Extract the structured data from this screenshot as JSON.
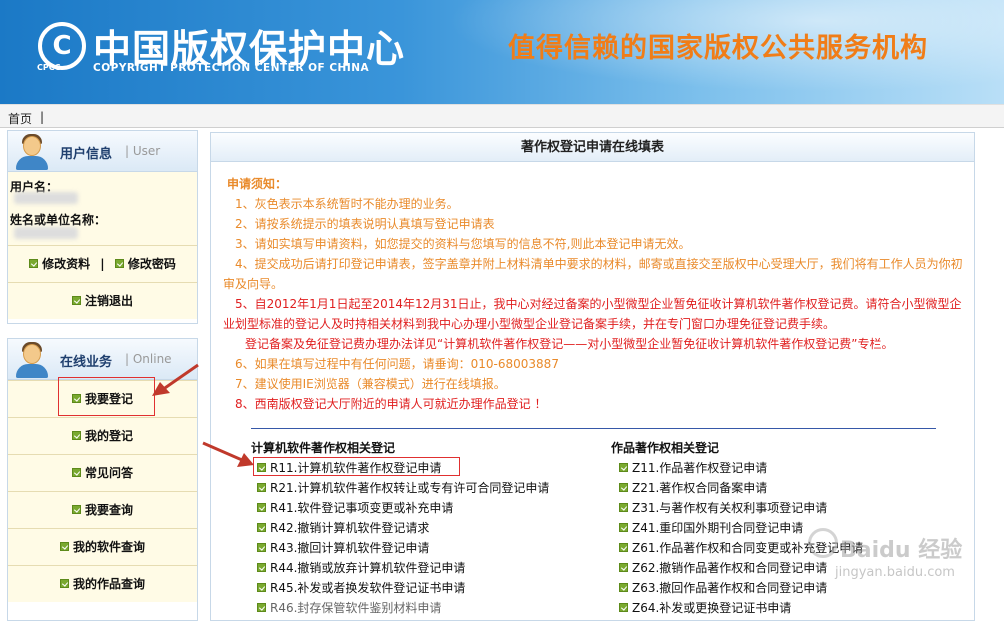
{
  "header": {
    "logo_circle": "C",
    "logo_abbr": "CPCC",
    "logo_cn": "中国版权保护中心",
    "logo_en": "COPYRIGHT PROTECTION CENTER OF CHINA",
    "slogan": "值得信赖的国家版权公共服务机构"
  },
  "breadcrumb": {
    "home": "首页",
    "sep": "|"
  },
  "user_box": {
    "title": "用户信息",
    "sub": "| User",
    "username_label": "用户名：",
    "name_label": "姓名或单位名称：",
    "edit_profile": "修改资料",
    "divider": "|",
    "edit_password": "修改密码",
    "logout": "注销退出"
  },
  "online_box": {
    "title": "在线业务",
    "sub": "| Online",
    "items": [
      {
        "label": "我要登记"
      },
      {
        "label": "我的登记"
      },
      {
        "label": "常见问答"
      },
      {
        "label": "我要查询"
      },
      {
        "label": "我的软件查询"
      },
      {
        "label": "我的作品查询"
      }
    ]
  },
  "panel": {
    "title": "著作权登记申请在线填表",
    "notice_title": "申请须知：",
    "notices": [
      "1、灰色表示本系统暂时不能办理的业务。",
      "2、请按系统提示的填表说明认真填写登记申请表",
      "3、请如实填写申请资料，如您提交的资料与您填写的信息不符,则此本登记申请无效。",
      "4、提交成功后请打印登记申请表，签字盖章并附上材料清单中要求的材料，邮寄或直接交至版权中心受理大厅，我们将有工作人员为你初",
      "审及向导。",
      "5、自2012年1月1日起至2014年12月31日止，我中心对经过备案的小型微型企业暂免征收计算机软件著作权登记费。请符合小型微型企",
      "业划型标准的登记人及时持相关材料到我中心办理小型微型企业登记备案手续，并在专门窗口办理免征登记费手续。",
      "登记备案及免征登记费办理办法详见“计算机软件著作权登记——对小型微型企业暂免征收计算机软件著作权登记费”专栏。",
      "6、如果在填写过程中有任何问题，请垂询：010-68003887",
      "7、建议使用IE浏览器（兼容模式）进行在线填报。",
      "8、西南版权登记大厅附近的申请人可就近办理作品登记 ！"
    ],
    "software_title": "计算机软件著作权相关登记",
    "software_items": [
      {
        "label": "R11.计算机软件著作权登记申请"
      },
      {
        "label": "R21.计算机软件著作权转让或专有许可合同登记申请"
      },
      {
        "label": "R41.软件登记事项变更或补充申请"
      },
      {
        "label": "R42.撤销计算机软件登记请求"
      },
      {
        "label": "R43.撤回计算机软件登记申请"
      },
      {
        "label": "R44.撤销或放弃计算机软件登记申请"
      },
      {
        "label": "R45.补发或者换发软件登记证书申请"
      },
      {
        "label": "R46.封存保管软件鉴别材料申请"
      }
    ],
    "works_title": "作品著作权相关登记",
    "works_items": [
      {
        "label": "Z11.作品著作权登记申请"
      },
      {
        "label": "Z21.著作权合同备案申请"
      },
      {
        "label": "Z31.与著作权有关权利事项登记申请"
      },
      {
        "label": "Z41.重印国外期刊合同登记申请"
      },
      {
        "label": "Z61.作品著作权和合同变更或补充登记申请"
      },
      {
        "label": "Z62.撤销作品著作权和合同登记申请"
      },
      {
        "label": "Z63.撤回作品著作权和合同登记申请"
      },
      {
        "label": "Z64.补发或更换登记证书申请"
      }
    ]
  },
  "watermark": {
    "text": "Baidu 经验",
    "sub": "jingyan.baidu.com"
  },
  "colors": {
    "accent_orange": "#f07d18",
    "notice_orange": "#e98a2a",
    "notice_red": "#e02020",
    "link_green": "#7aa92f"
  }
}
